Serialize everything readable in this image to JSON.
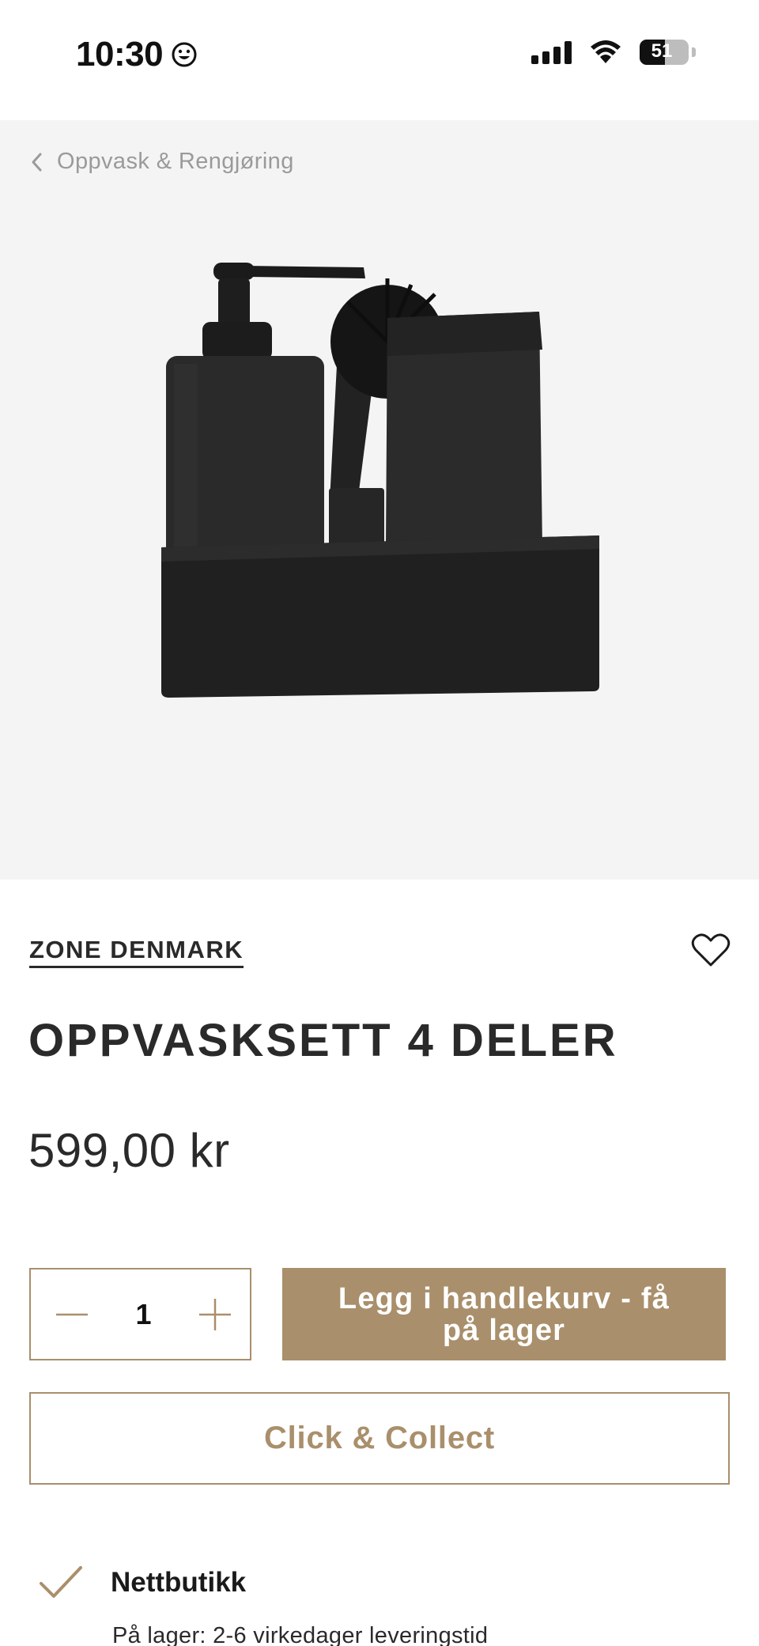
{
  "status_bar": {
    "time": "10:30",
    "battery_percent": "51",
    "battery_level": 0.51
  },
  "breadcrumb": {
    "label": "Oppvask & Rengjøring"
  },
  "product": {
    "brand": "ZONE DENMARK",
    "name": "OPPVASKSETT 4 DELER",
    "price": "599,00 kr",
    "image_icon": "dish-set-image"
  },
  "cart": {
    "quantity": "1",
    "add_to_cart_label": "Legg i handlekurv - få på lager",
    "click_collect_label": "Click & Collect"
  },
  "availability": {
    "title": "Nettbutikk",
    "subtitle": "På lager: 2-6 virkedager leveringstid"
  },
  "colors": {
    "accent": "#a98f6b",
    "text": "#2a2a2a",
    "gallery_bg": "#f4f4f4",
    "breadcrumb": "#9a9a9a"
  }
}
